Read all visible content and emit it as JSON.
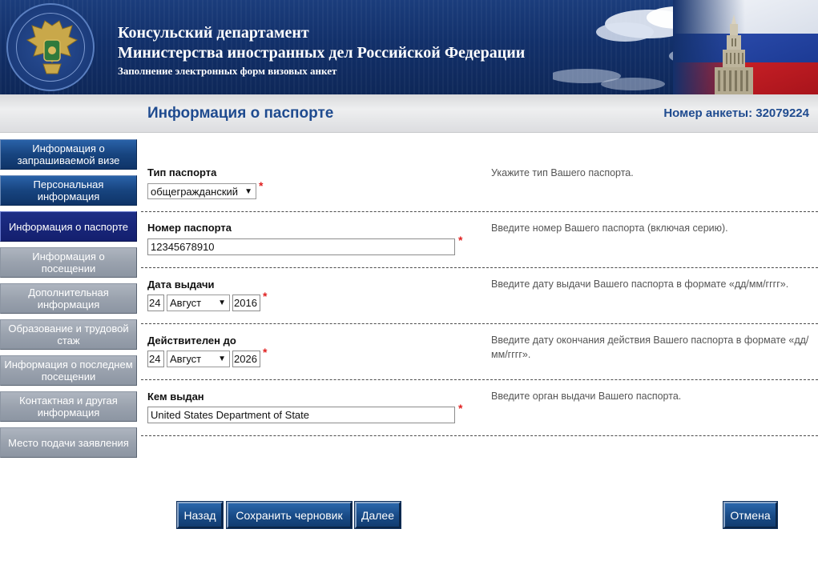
{
  "header": {
    "title_line1": "Консульский департамент",
    "title_line2": "Министерства иностранных дел Российской Федерации",
    "subtitle": "Заполнение электронных форм визовых анкет"
  },
  "page": {
    "title": "Информация о паспорте",
    "application_number": "Номер анкеты: 32079224"
  },
  "sidebar": {
    "items": [
      {
        "label": "Информация о запрашиваемой визе",
        "state": "done"
      },
      {
        "label": "Персональная информация",
        "state": "done"
      },
      {
        "label": "Информация о паспорте",
        "state": "current"
      },
      {
        "label": "Информация о посещении",
        "state": "todo"
      },
      {
        "label": "Дополнительная информация",
        "state": "todo"
      },
      {
        "label": "Образование и трудовой стаж",
        "state": "todo"
      },
      {
        "label": "Информация о последнем посещении",
        "state": "todo"
      },
      {
        "label": "Контактная и другая информация",
        "state": "todo"
      },
      {
        "label": "Место подачи заявления",
        "state": "todo"
      }
    ]
  },
  "form": {
    "passport_type": {
      "label": "Тип паспорта",
      "value": "общегражданский",
      "hint": "Укажите тип Вашего паспорта."
    },
    "passport_number": {
      "label": "Номер паспорта",
      "value": "12345678910",
      "hint": "Введите номер Вашего паспорта (включая серию)."
    },
    "issue_date": {
      "label": "Дата выдачи",
      "day": "24",
      "month": "Август",
      "year": "2016",
      "hint": "Введите дату выдачи Вашего паспорта в формате «дд/мм/гггг»."
    },
    "expiry_date": {
      "label": "Действителен до",
      "day": "24",
      "month": "Август",
      "year": "2026",
      "hint": "Введите дату окончания действия Вашего паспорта в формате «дд/мм/гггг»."
    },
    "issued_by": {
      "label": "Кем выдан",
      "value": "United States Department of State",
      "hint": "Введите орган выдачи Вашего паспорта."
    },
    "required_mark": "*"
  },
  "buttons": {
    "back": "Назад",
    "save_draft": "Сохранить черновик",
    "next": "Далее",
    "cancel": "Отмена"
  },
  "icons": {
    "dropdown": "▼"
  },
  "colors": {
    "title_blue": "#1f4b8f",
    "nav_done": "#17447f",
    "nav_current": "#141f6e",
    "nav_todo": "#9aa2ae",
    "required": "#e02020"
  }
}
